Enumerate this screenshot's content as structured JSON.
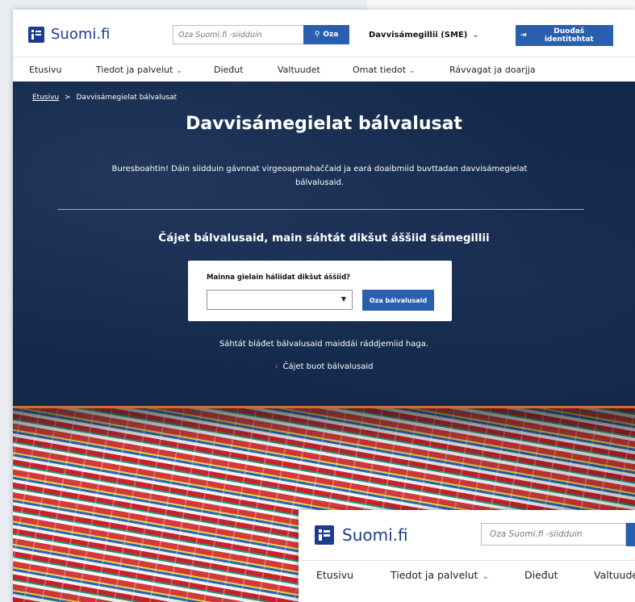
{
  "header": {
    "logo_text": "Suomi.fi",
    "search_placeholder": "Oza Suomi.fi -siidduin",
    "search_button": "Oza",
    "language": "Davvisámegillii (SME)",
    "login_button": "Duođaš identitehtat"
  },
  "nav": {
    "items": [
      "Etusivu",
      "Tiedot ja palvelut",
      "Dieđut",
      "Valtuudet",
      "Omat tiedot",
      "Rávvagat ja doarjja"
    ]
  },
  "breadcrumb": {
    "home": "Etusivu",
    "separator": ">",
    "current": "Davvisámegielat bálvalusat"
  },
  "hero": {
    "title": "Davvisámegielat bálvalusat",
    "intro": "Buresboahtin! Dáin siidduin gávnnat virgeoapmahaččaid ja eará doaibmiid buvttadan davvisámegielat bálvalusaid.",
    "subtitle": "Čájet bálvalusaid, main sáhtát dikšut áššiid sámegillii",
    "select_label": "Mainna gielain háliidat dikšut áššiid?",
    "select_value": "",
    "select_button": "Oza bálvalusaid",
    "hint": "Sáhtát bláđet bálvalusaid maiddái ráddjemiid haga.",
    "all_link": "Čájet buot bálvalusaid"
  },
  "overlay": {
    "logo_text": "Suomi.fi",
    "search_placeholder": "Oza Suomi.fi -siidduin",
    "nav": [
      "Etusivu",
      "Tiedot ja palvelut",
      "Dieđut",
      "Valtuude"
    ]
  },
  "colors": {
    "brand": "#1c3d8c",
    "button": "#2a5fb0",
    "hero_bg": "#13294b",
    "accent": "#e0692b"
  }
}
